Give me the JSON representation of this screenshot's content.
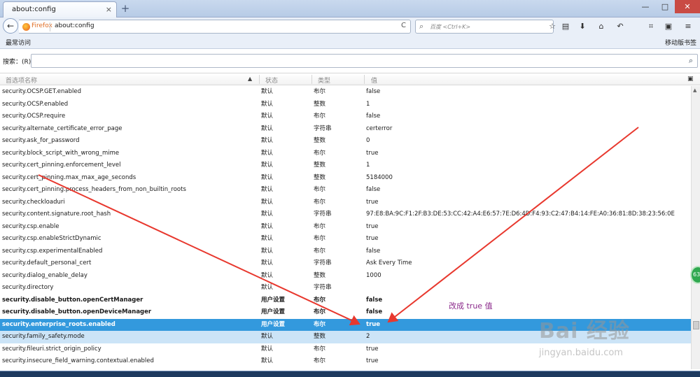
{
  "window": {
    "tab_title": "about:config",
    "tab_close": "×",
    "new_tab": "+",
    "minimize": "—",
    "maximize": "□",
    "close": "✕"
  },
  "navbar": {
    "back_icon": "←",
    "identity": "Firefox",
    "url": "about:config",
    "reload_icon": "C",
    "search_placeholder": "百度 <Ctrl+K>",
    "icons": [
      "star-icon",
      "reader-icon",
      "download-icon",
      "home-icon",
      "undo-icon",
      "crop-icon",
      "screenshot-icon",
      "menu-icon"
    ]
  },
  "bookmarks": {
    "left": "最常访问",
    "right": "移动版书签"
  },
  "filter": {
    "label": "搜索：(R)",
    "value": ""
  },
  "columns": {
    "name": "首选项名称",
    "status": "状态",
    "type": "类型",
    "value": "值"
  },
  "rows": [
    {
      "name": "security.OCSP.GET.enabled",
      "status": "默认",
      "type": "布尔",
      "value": "false"
    },
    {
      "name": "security.OCSP.enabled",
      "status": "默认",
      "type": "整数",
      "value": "1"
    },
    {
      "name": "security.OCSP.require",
      "status": "默认",
      "type": "布尔",
      "value": "false"
    },
    {
      "name": "security.alternate_certificate_error_page",
      "status": "默认",
      "type": "字符串",
      "value": "certerror"
    },
    {
      "name": "security.ask_for_password",
      "status": "默认",
      "type": "整数",
      "value": "0"
    },
    {
      "name": "security.block_script_with_wrong_mime",
      "status": "默认",
      "type": "布尔",
      "value": "true"
    },
    {
      "name": "security.cert_pinning.enforcement_level",
      "status": "默认",
      "type": "整数",
      "value": "1"
    },
    {
      "name": "security.cert_pinning.max_max_age_seconds",
      "status": "默认",
      "type": "整数",
      "value": "5184000"
    },
    {
      "name": "security.cert_pinning.process_headers_from_non_builtin_roots",
      "status": "默认",
      "type": "布尔",
      "value": "false"
    },
    {
      "name": "security.checkloaduri",
      "status": "默认",
      "type": "布尔",
      "value": "true"
    },
    {
      "name": "security.content.signature.root_hash",
      "status": "默认",
      "type": "字符串",
      "value": "97:E8:BA:9C:F1:2F:B3:DE:53:CC:42:A4:E6:57:7E:D6:4D:F4:93:C2:47:B4:14:FE:A0:36:81:8D:38:23:56:0E"
    },
    {
      "name": "security.csp.enable",
      "status": "默认",
      "type": "布尔",
      "value": "true"
    },
    {
      "name": "security.csp.enableStrictDynamic",
      "status": "默认",
      "type": "布尔",
      "value": "true"
    },
    {
      "name": "security.csp.experimentalEnabled",
      "status": "默认",
      "type": "布尔",
      "value": "false"
    },
    {
      "name": "security.default_personal_cert",
      "status": "默认",
      "type": "字符串",
      "value": "Ask Every Time"
    },
    {
      "name": "security.dialog_enable_delay",
      "status": "默认",
      "type": "整数",
      "value": "1000"
    },
    {
      "name": "security.directory",
      "status": "默认",
      "type": "字符串",
      "value": ""
    },
    {
      "name": "security.disable_button.openCertManager",
      "status": "用户设置",
      "type": "布尔",
      "value": "false",
      "bold": true
    },
    {
      "name": "security.disable_button.openDeviceManager",
      "status": "用户设置",
      "type": "布尔",
      "value": "false",
      "bold": true
    },
    {
      "name": "security.enterprise_roots.enabled",
      "status": "用户设置",
      "type": "布尔",
      "value": "true",
      "bold": true,
      "selected": true
    },
    {
      "name": "security.family_safety.mode",
      "status": "默认",
      "type": "整数",
      "value": "2",
      "hover": true
    },
    {
      "name": "security.fileuri.strict_origin_policy",
      "status": "默认",
      "type": "布尔",
      "value": "true"
    },
    {
      "name": "security.insecure_field_warning.contextual.enabled",
      "status": "默认",
      "type": "布尔",
      "value": "true"
    }
  ],
  "annotation": {
    "text": "改成 true 值",
    "color": "#8b2a8b",
    "arrow_color": "#e8382e"
  },
  "badge": "63",
  "watermark": {
    "title": "Bai 经验",
    "sub": "jingyan.baidu.com"
  },
  "colors": {
    "selected_row": "#3399dd",
    "hover_row": "#cce4f7"
  }
}
